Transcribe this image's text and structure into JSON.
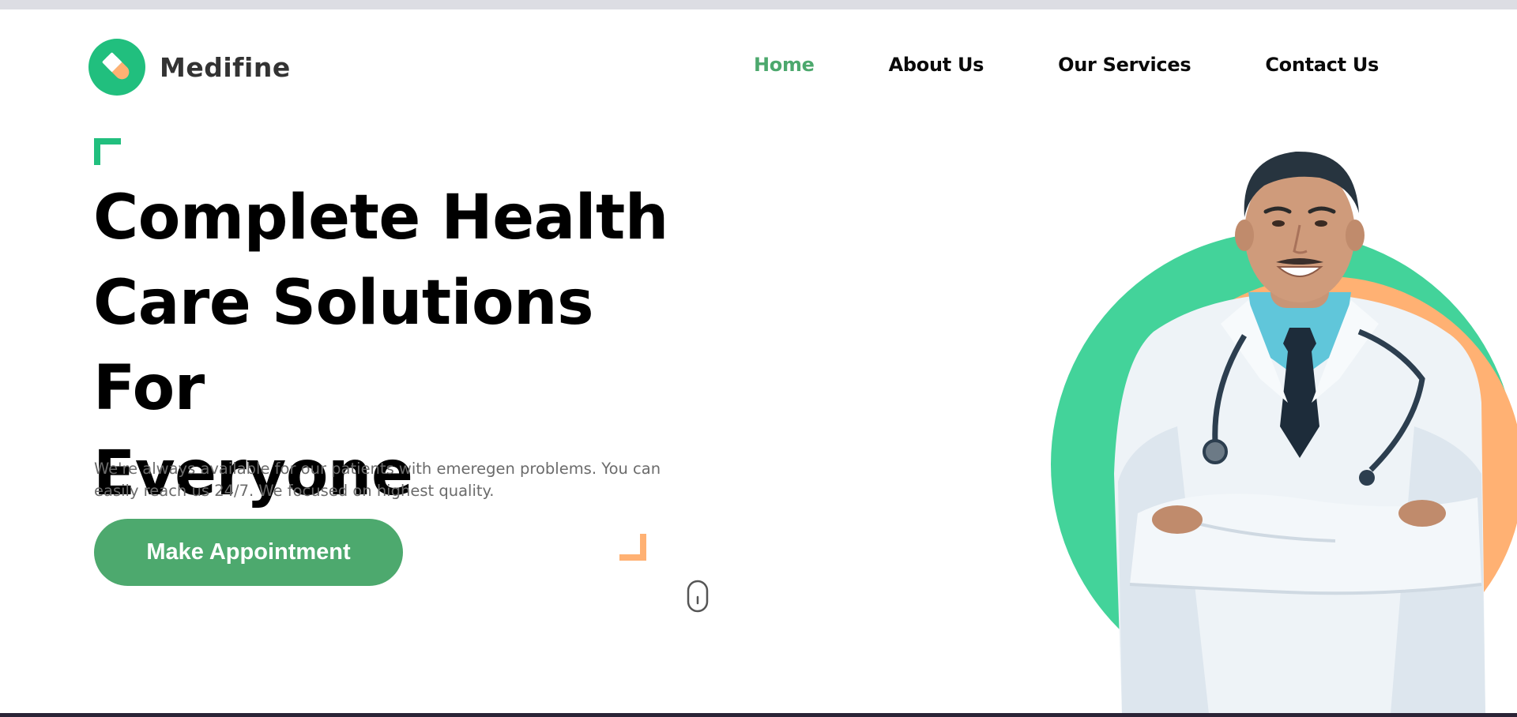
{
  "header": {
    "brand_name": "Medifine",
    "logo_icon": "pill-icon",
    "nav": [
      {
        "label": "Home",
        "active": true
      },
      {
        "label": "About Us",
        "active": false
      },
      {
        "label": "Our Services",
        "active": false
      },
      {
        "label": "Contact Us",
        "active": false
      }
    ]
  },
  "hero": {
    "title_lines": [
      "Complete Health",
      "Care Solutions For",
      "Everyone"
    ],
    "description_lines": [
      "We're always available for our patients with emeregen problems. You can",
      "easily reach us 24/7. We focused on highest quality."
    ],
    "cta_label": "Make Appointment",
    "scroll_icon": "mouse-scroll-icon",
    "image": "doctor-portrait"
  },
  "colors": {
    "brand_green": "#21bf7e",
    "nav_active": "#4ca86d",
    "cta_green": "#4da96e",
    "accent_orange": "#ffb173",
    "circle_green": "#43d39a"
  }
}
